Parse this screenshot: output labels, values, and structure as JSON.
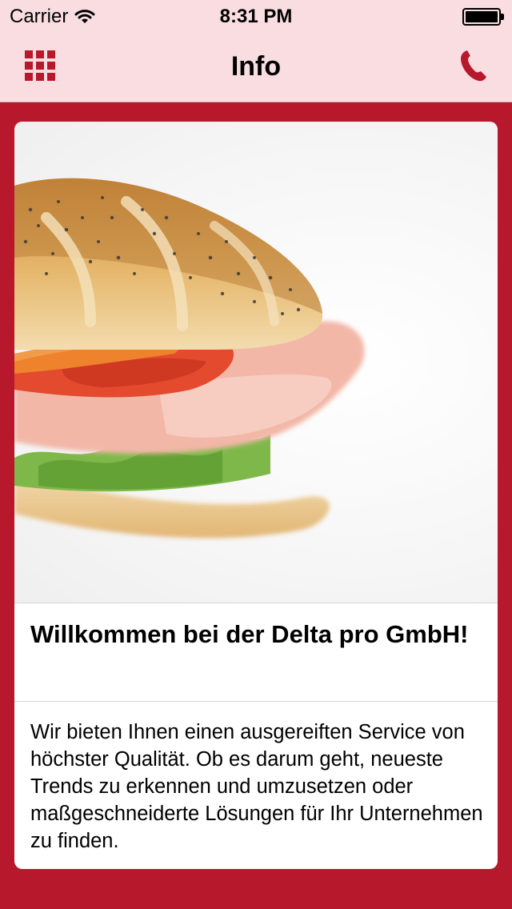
{
  "status_bar": {
    "carrier": "Carrier",
    "time": "8:31 PM",
    "wifi_icon": "wifi-icon",
    "battery_icon": "battery-icon"
  },
  "nav": {
    "title": "Info",
    "menu_icon": "grid-menu-icon",
    "call_icon": "phone-icon"
  },
  "card": {
    "image": "sandwich-photo",
    "headline": "Willkommen bei der Delta pro GmbH!",
    "body": "Wir bieten Ihnen einen ausgereiften Service von höchster Qualität. Ob es darum geht, neueste Trends zu erkennen und umzusetzen oder maßgeschneiderte Lösungen für Ihr Unternehmen zu finden."
  },
  "colors": {
    "accent": "#b8182c",
    "navbar_bg": "#f9dde1",
    "card_bg": "#ffffff"
  }
}
